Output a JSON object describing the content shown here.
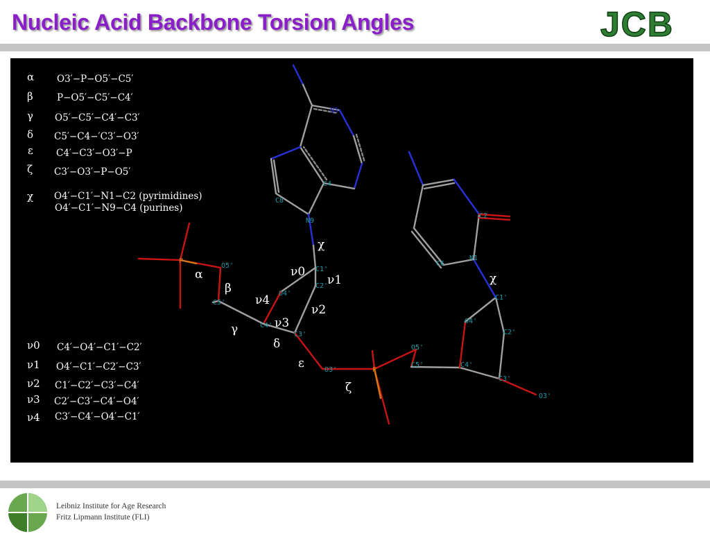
{
  "title": "Nucleic Acid Backbone Torsion Angles",
  "logo_text": "JCB",
  "backbone_angles": [
    {
      "symbol": "α",
      "definition": "O3′−P−O5′−C5′"
    },
    {
      "symbol": "β",
      "definition": "P−O5′−C5′−C4′"
    },
    {
      "symbol": "γ",
      "definition": "O5′−C5′−C4′−C3′"
    },
    {
      "symbol": "δ",
      "definition": "C5′−C4−′C3′−O3′"
    },
    {
      "symbol": "ε",
      "definition": "C4′−C3′−O3′−P"
    },
    {
      "symbol": "ζ",
      "definition": "C3′−O3′−P−O5′"
    }
  ],
  "chi": {
    "symbol": "χ",
    "definition_pyrimidines": "O4′−C1′−N1−C2 (pyrimidines)",
    "definition_purines": "O4′−C1′−N9−C4 (purines)"
  },
  "sugar_angles": [
    {
      "symbol": "ν0",
      "definition": "C4′−O4′−C1′−C2′"
    },
    {
      "symbol": "ν1",
      "definition": "O4′−C1′−C2′−C3′"
    },
    {
      "symbol": "ν2",
      "definition": "C1′−C2′−C3′−C4′"
    },
    {
      "symbol": "ν3",
      "definition": "C2′−C3′−C4′−O4′"
    },
    {
      "symbol": "ν4",
      "definition": "C3′−C4′−O4′−C1′"
    }
  ],
  "molecule_angle_labels": {
    "chi_1": "χ",
    "chi_2": "χ",
    "alpha": "α",
    "beta": "β",
    "gamma": "γ",
    "delta": "δ",
    "epsilon": "ε",
    "zeta": "ζ",
    "nu0": "ν0",
    "nu1": "ν1",
    "nu2": "ν2",
    "nu3": "ν3",
    "nu4": "ν4"
  },
  "atom_labels": {
    "p1": "P",
    "o5_1": "O5'",
    "c5_1": "C5'",
    "c4_1": "C4'",
    "o4_1": "O4'",
    "c1_1": "C1'",
    "c2_1": "C2'",
    "c3_1": "C3'",
    "o3_1": "O3'",
    "n9": "N9",
    "c8": "C8",
    "c4_base": "C4",
    "n3": "N3",
    "p2": "P",
    "o5_2": "O5'",
    "c5_2": "C5'",
    "c4_2": "C4'",
    "o4_2": "O4'",
    "c1_2": "C1'",
    "c2_2": "C2'",
    "c3_2": "C3'",
    "o3_2": "O3'",
    "n1": "N1",
    "c6": "C6",
    "c2_base": "C2"
  },
  "colors": {
    "title": "#8a1ec9",
    "bond": "#a0a0a0",
    "oxygen": "#c81414",
    "nitrogen": "#2632d8",
    "phosphorus": "#d27814",
    "atom_label": "#1f9aa8",
    "logo_green": "#2e7d32"
  },
  "footer": {
    "line1": "Leibniz Institute for Age Research",
    "line2": "Fritz Lipmann Institute (FLI)"
  }
}
